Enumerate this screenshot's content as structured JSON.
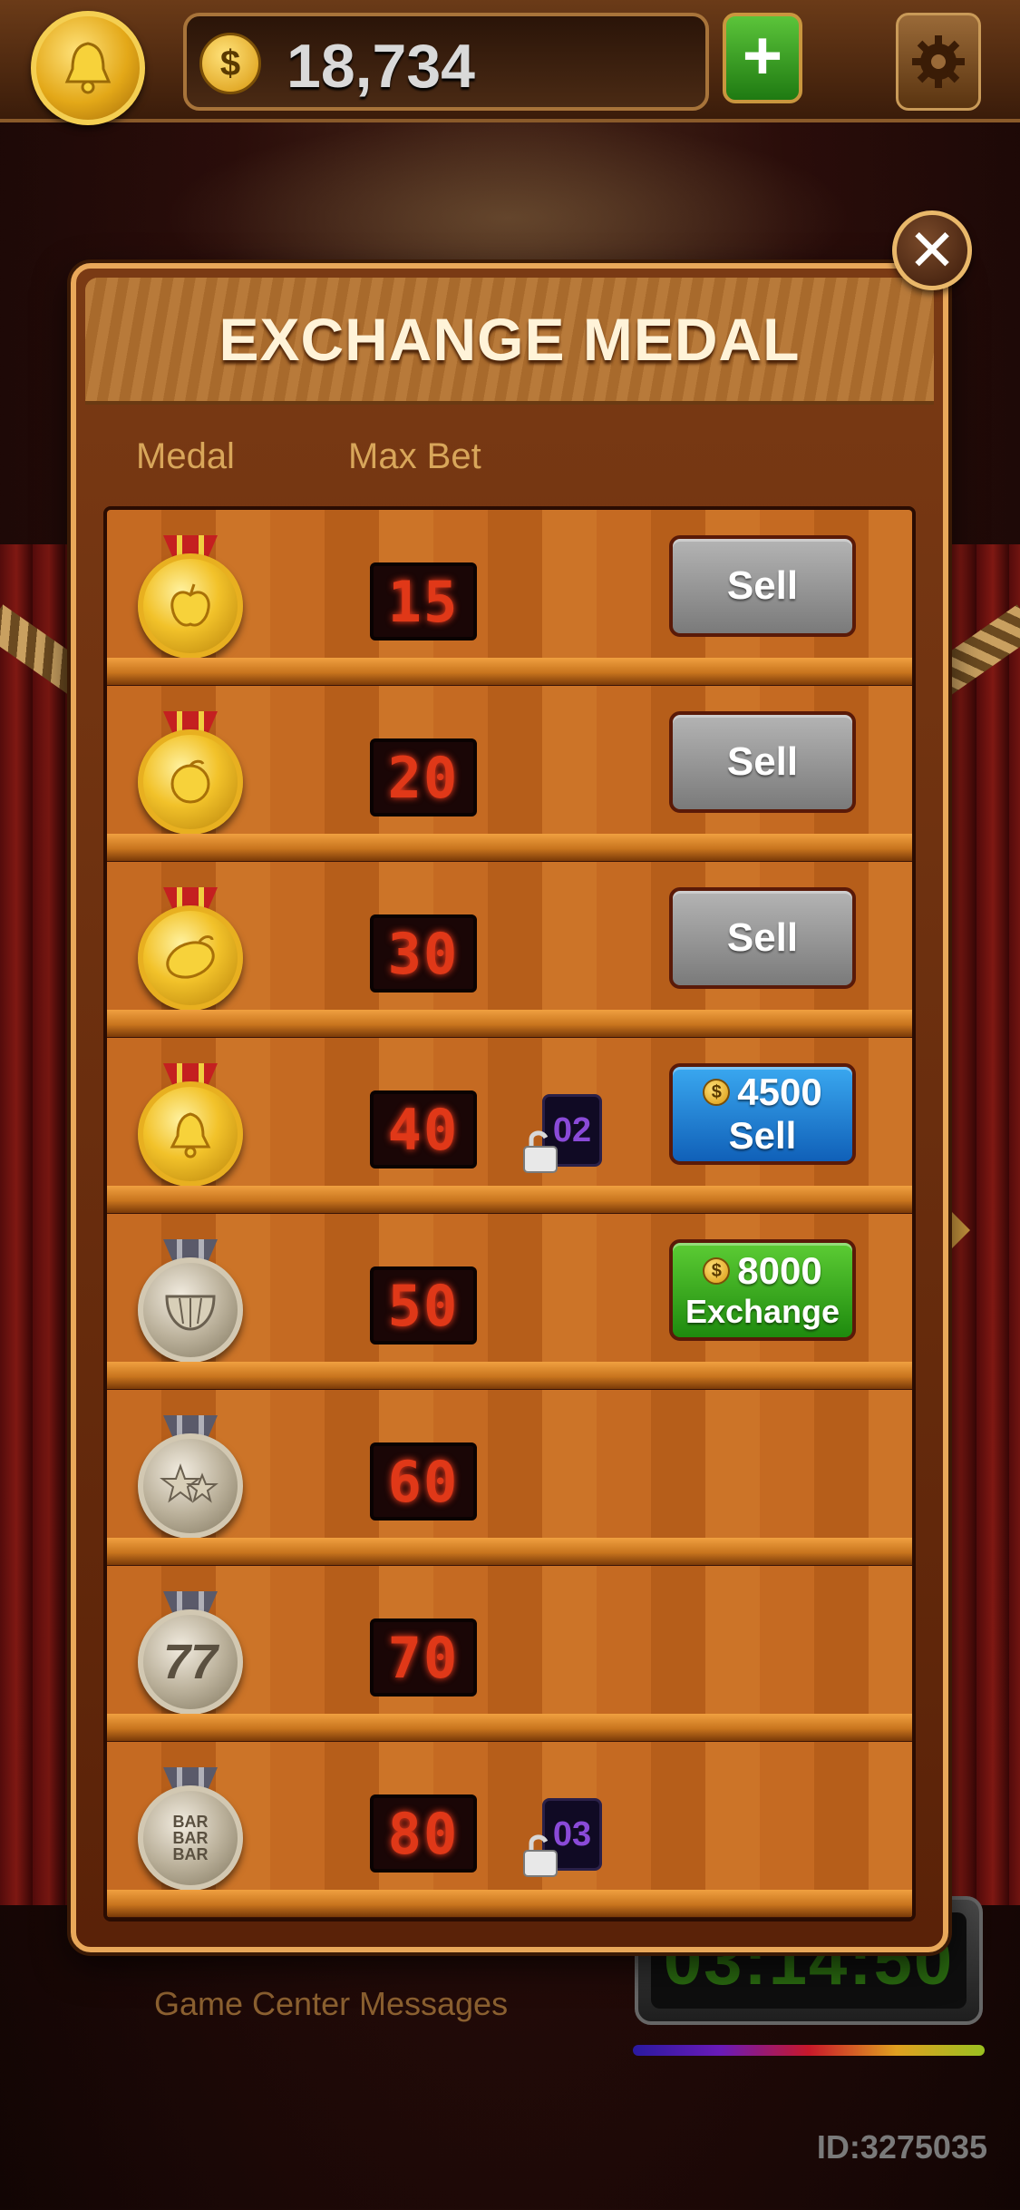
{
  "topbar": {
    "coins": "18,734",
    "coin_symbol": "$",
    "add_label": "+",
    "settings_icon": "gear-icon"
  },
  "modal": {
    "title": "EXCHANGE MEDAL",
    "close_label": "✕",
    "col_medal": "Medal",
    "col_max_bet": "Max Bet",
    "rows": [
      {
        "medal": "apple",
        "tier": "gold",
        "max_bet": "15",
        "action": "Sell",
        "button": "gray"
      },
      {
        "medal": "orange",
        "tier": "gold",
        "max_bet": "20",
        "action": "Sell",
        "button": "gray"
      },
      {
        "medal": "lemon",
        "tier": "gold",
        "max_bet": "30",
        "action": "Sell",
        "button": "gray"
      },
      {
        "medal": "bell",
        "tier": "gold",
        "max_bet": "40",
        "lock": "02",
        "price": "4500",
        "action": "Sell",
        "button": "blue"
      },
      {
        "medal": "watermelon",
        "tier": "silver",
        "max_bet": "50",
        "price": "8000",
        "action": "Exchange",
        "button": "green"
      },
      {
        "medal": "stars",
        "tier": "silver",
        "max_bet": "60"
      },
      {
        "medal": "seventy-seven",
        "tier": "silver",
        "max_bet": "70",
        "symbol": "77"
      },
      {
        "medal": "bar",
        "tier": "silver",
        "max_bet": "80",
        "lock": "03",
        "symbol": "BAR\nBAR\nBAR"
      }
    ]
  },
  "bottom": {
    "game_center": "Game Center",
    "messages": "Messages",
    "timer": "03:14:50",
    "player_id": "ID:3275035"
  },
  "colors": {
    "accent_gold": "#e9a85a",
    "led_red": "#e03818",
    "timer_green": "#2a6a10"
  }
}
